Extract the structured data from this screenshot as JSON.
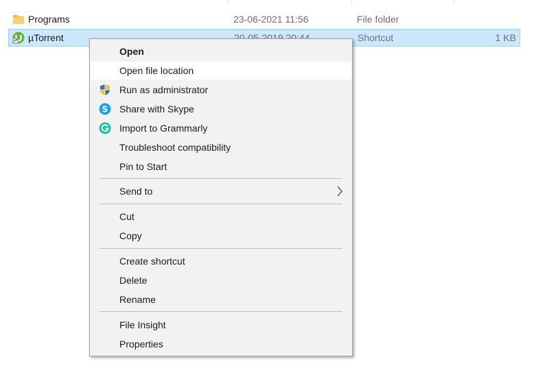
{
  "files": [
    {
      "name": "Programs",
      "modified": "23-06-2021 11:56",
      "type": "File folder",
      "size": "",
      "icon": "folder-icon"
    },
    {
      "name": "µTorrent",
      "modified": "20-05-2019 20:44",
      "type": "Shortcut",
      "size": "1 KB",
      "icon": "utorrent-icon"
    }
  ],
  "menu": {
    "open": "Open",
    "open_file_location": "Open file location",
    "run_as_admin": "Run as administrator",
    "share_skype": "Share with Skype",
    "import_grammarly": "Import to Grammarly",
    "troubleshoot": "Troubleshoot compatibility",
    "pin_to_start": "Pin to Start",
    "send_to": "Send to",
    "cut": "Cut",
    "copy": "Copy",
    "create_shortcut": "Create shortcut",
    "delete": "Delete",
    "rename": "Rename",
    "file_insight": "File Insight",
    "properties": "Properties"
  },
  "colors": {
    "selection": "#cce8ff",
    "menu_bg": "#f2f2f2",
    "hover": "#ffffff",
    "skype": "#1da1f2",
    "grammarly": "#15c39a"
  }
}
